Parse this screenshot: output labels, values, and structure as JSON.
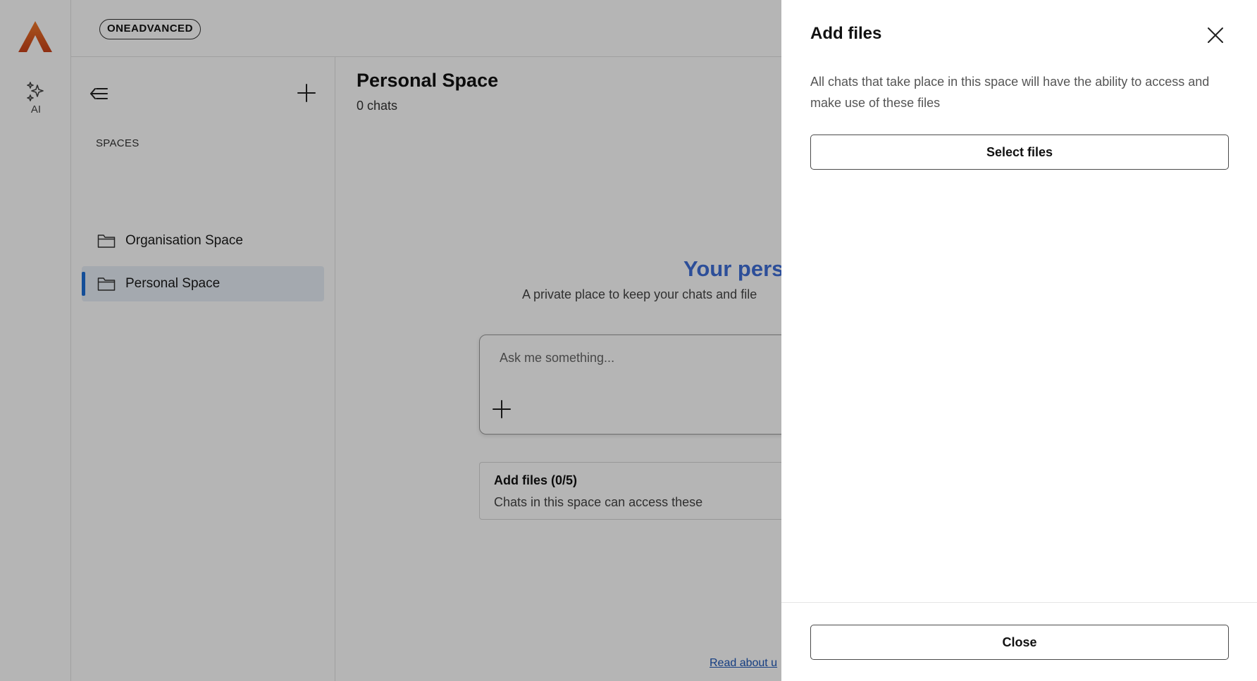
{
  "brand": {
    "pill_label": "ONEADVANCED"
  },
  "rail": {
    "ai_label": "AI"
  },
  "sidebar": {
    "section_label": "SPACES",
    "items": [
      {
        "label": "Organisation Space",
        "active": false
      },
      {
        "label": "Personal Space",
        "active": true
      }
    ]
  },
  "main": {
    "title": "Personal Space",
    "subtitle": "0 chats",
    "hero_title": "Your pers",
    "hero_subtitle": "A private place to keep your chats and file",
    "ask_placeholder": "Ask me something...",
    "files_card": {
      "title": "Add files (0/5)",
      "subtitle": "Chats in this space can access these"
    },
    "read_link": "Read about u"
  },
  "drawer": {
    "title": "Add files",
    "description": "All chats that take place in this space will have the ability to access and make use of these files",
    "select_button": "Select files",
    "close_button": "Close"
  },
  "colors": {
    "accent": "#1d6fd6",
    "hero": "#3f6fd8",
    "logo": "#d9561f",
    "overlay": "rgba(0,0,0,0.29)"
  },
  "icons": [
    "logo-icon",
    "ai-sparkle-icon",
    "collapse-sidebar-icon",
    "plus-icon",
    "folder-icon",
    "close-icon"
  ]
}
